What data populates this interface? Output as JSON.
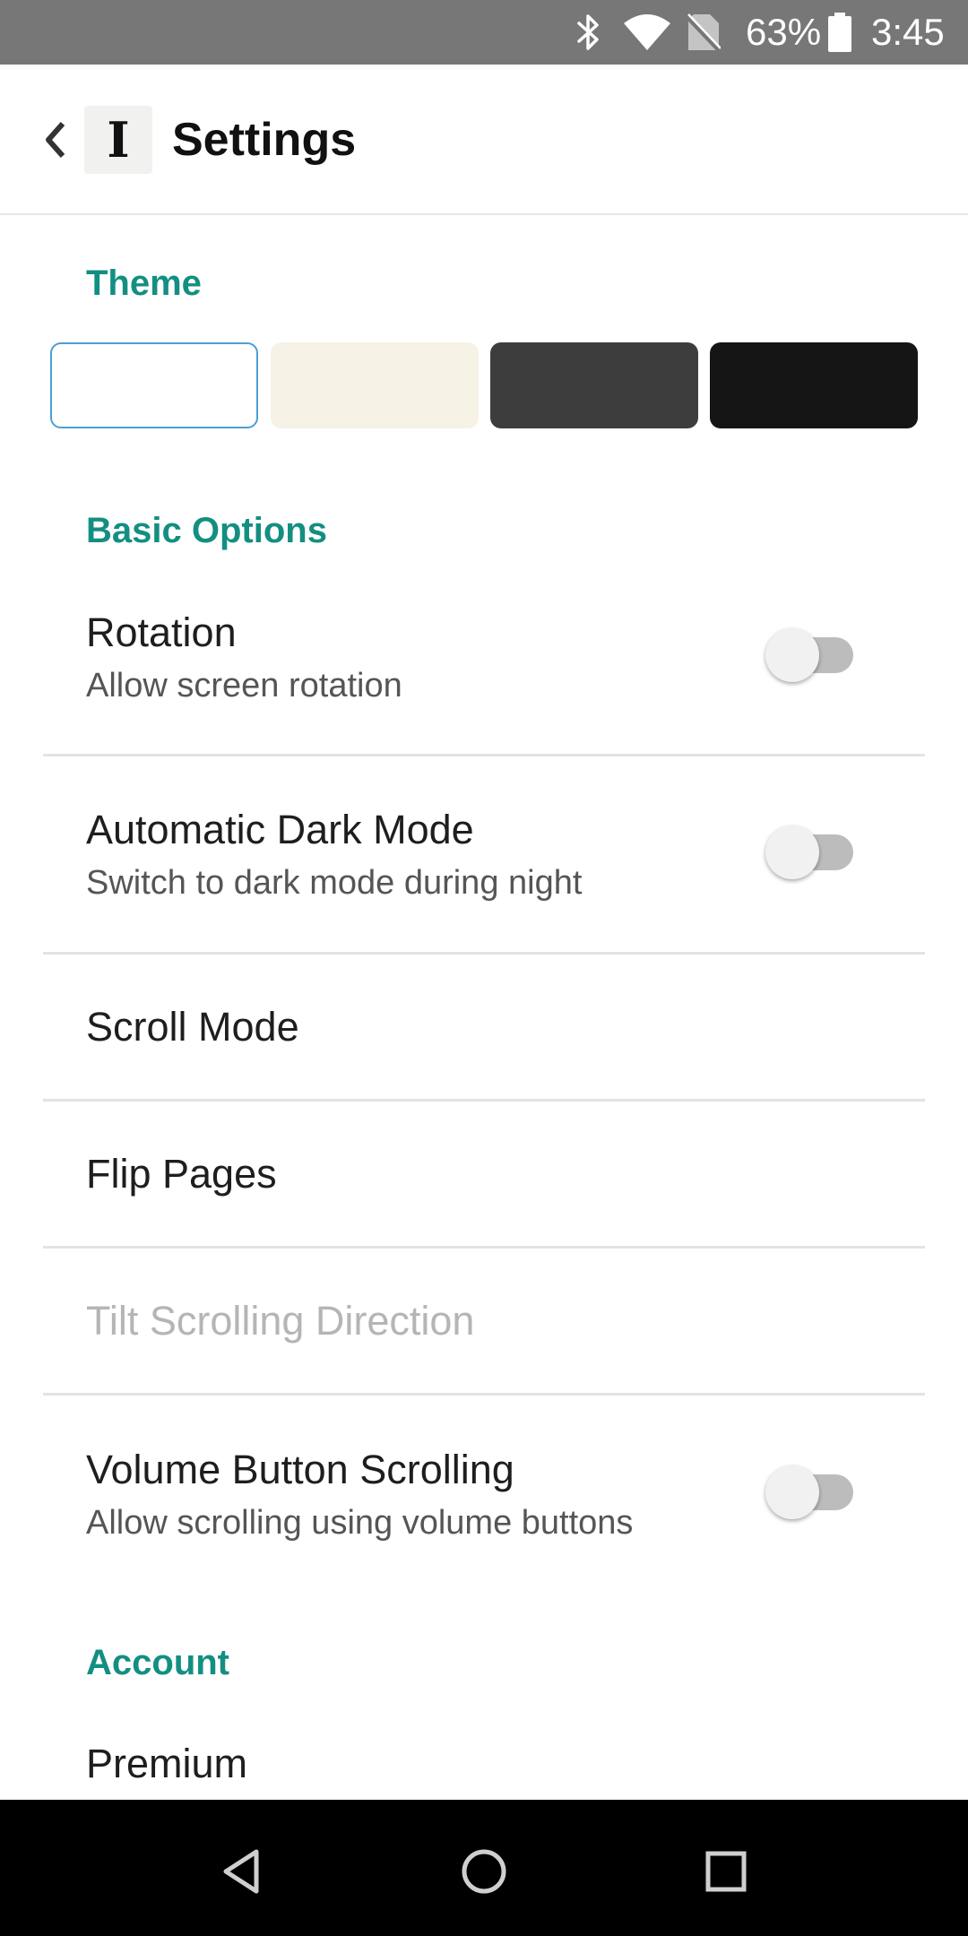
{
  "status_bar": {
    "battery_percent": "63%",
    "time": "3:45",
    "icons": [
      "bluetooth-icon",
      "wifi-icon",
      "no-sim-icon",
      "battery-icon"
    ]
  },
  "app_bar": {
    "back_icon": "chevron-left-icon",
    "logo_letter": "I",
    "title": "Settings"
  },
  "theme": {
    "header": "Theme",
    "swatches": [
      {
        "name": "white",
        "color": "#ffffff",
        "selected": true
      },
      {
        "name": "sepia",
        "color": "#f7f2e6",
        "selected": false
      },
      {
        "name": "dark-gray",
        "color": "#3d3d3d",
        "selected": false
      },
      {
        "name": "black",
        "color": "#151515",
        "selected": false
      }
    ],
    "selected_border_color": "#4a9fd4"
  },
  "basic_options": {
    "header": "Basic Options",
    "rotation": {
      "title": "Rotation",
      "subtitle": "Allow screen rotation",
      "enabled": false
    },
    "dark_mode": {
      "title": "Automatic Dark Mode",
      "subtitle": "Switch to dark mode during night",
      "enabled": false
    },
    "scroll_mode": {
      "title": "Scroll Mode"
    },
    "flip_pages": {
      "title": "Flip Pages"
    },
    "tilt_scrolling": {
      "title": "Tilt Scrolling Direction",
      "disabled": true
    },
    "volume_scrolling": {
      "title": "Volume Button Scrolling",
      "subtitle": "Allow scrolling using volume buttons",
      "enabled": false
    }
  },
  "account": {
    "header": "Account",
    "premium": {
      "title": "Premium"
    }
  },
  "colors": {
    "accent": "#138f82",
    "status_bar": "#777777",
    "nav_bar": "#000000"
  },
  "nav_bar": {
    "icons": [
      "back-triangle-icon",
      "home-circle-icon",
      "recents-square-icon"
    ]
  }
}
